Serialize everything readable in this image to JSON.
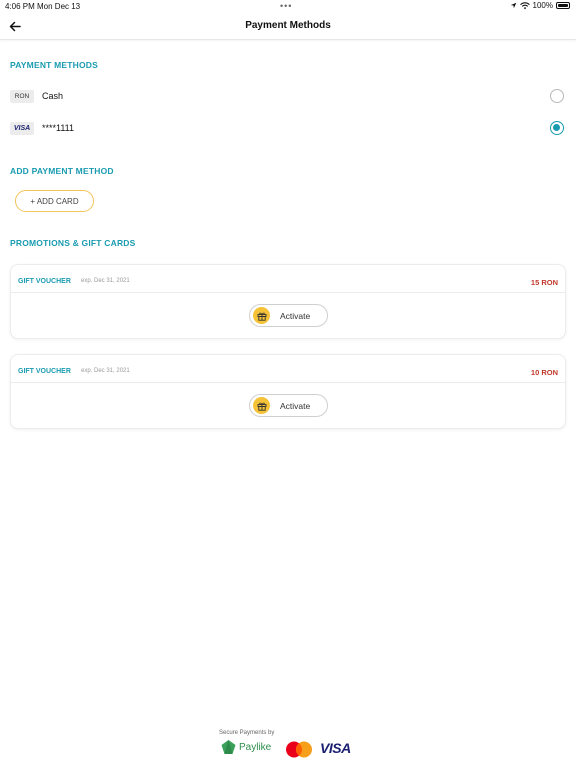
{
  "status_bar": {
    "time": "4:06 PM",
    "date": "Mon Dec 13",
    "battery": "100%"
  },
  "header": {
    "title": "Payment Methods"
  },
  "payment_methods": {
    "title": "PAYMENT METHODS",
    "items": [
      {
        "badge": "RON",
        "label": "Cash",
        "selected": false
      },
      {
        "badge": "VISA",
        "label": "****1111",
        "selected": true
      }
    ]
  },
  "add_payment": {
    "title": "ADD PAYMENT METHOD",
    "button_label": "+ ADD CARD"
  },
  "promotions": {
    "title": "PROMOTIONS & GIFT CARDS",
    "vouchers": [
      {
        "name": "GIFT VOUCHER",
        "expiry": "exp. Dec 31, 2021",
        "amount": "15 RON",
        "action": "Activate"
      },
      {
        "name": "GIFT VOUCHER",
        "expiry": "exp. Dec 31, 2021",
        "amount": "10 RON",
        "action": "Activate"
      }
    ]
  },
  "footer": {
    "secure_text": "Secure Payments by",
    "paylike_label": "Paylike",
    "visa_label": "VISA"
  },
  "colors": {
    "accent": "#1a9bb0",
    "amount": "#c0392b",
    "button_border": "#f2c45a",
    "gift_icon": "#f5c238"
  }
}
